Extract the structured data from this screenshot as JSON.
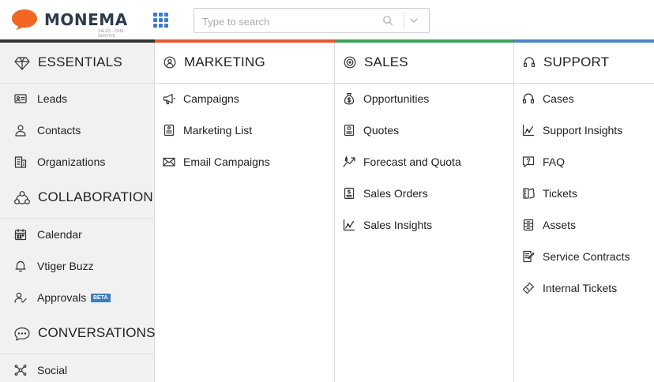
{
  "brand": {
    "name": "MONEMA",
    "tagline": "SALES · CRM · SERVICE",
    "logo_color": "#f26522"
  },
  "search": {
    "placeholder": "Type to search",
    "value": ""
  },
  "colors": {
    "essentials": "#333333",
    "marketing": "#e8572a",
    "sales": "#3aa35c",
    "support": "#4a86c8",
    "beta_badge": "#3b7dc4"
  },
  "essentials": {
    "title": "ESSENTIALS",
    "items": [
      {
        "label": "Leads",
        "icon": "id-card-icon"
      },
      {
        "label": "Contacts",
        "icon": "person-icon"
      },
      {
        "label": "Organizations",
        "icon": "building-icon"
      }
    ]
  },
  "collaboration": {
    "title": "COLLABORATION",
    "items": [
      {
        "label": "Calendar",
        "icon": "calendar-icon"
      },
      {
        "label": "Vtiger Buzz",
        "icon": "bell-icon"
      },
      {
        "label": "Approvals",
        "icon": "person-check-icon",
        "badge": "BETA"
      }
    ]
  },
  "conversations": {
    "title": "CONVERSATIONS",
    "items": [
      {
        "label": "Social",
        "icon": "network-icon"
      }
    ]
  },
  "marketing": {
    "title": "MARKETING",
    "items": [
      {
        "label": "Campaigns",
        "icon": "megaphone-icon"
      },
      {
        "label": "Marketing List",
        "icon": "list-icon"
      },
      {
        "label": "Email Campaigns",
        "icon": "envelope-icon"
      }
    ]
  },
  "sales": {
    "title": "SALES",
    "items": [
      {
        "label": "Opportunities",
        "icon": "money-bag-icon"
      },
      {
        "label": "Quotes",
        "icon": "quote-doc-icon"
      },
      {
        "label": "Forecast and Quota",
        "icon": "forecast-icon"
      },
      {
        "label": "Sales Orders",
        "icon": "order-doc-icon"
      },
      {
        "label": "Sales Insights",
        "icon": "chart-icon"
      }
    ]
  },
  "support": {
    "title": "SUPPORT",
    "items": [
      {
        "label": "Cases",
        "icon": "headset-icon"
      },
      {
        "label": "Support Insights",
        "icon": "chart-icon"
      },
      {
        "label": "FAQ",
        "icon": "question-bubble-icon"
      },
      {
        "label": "Tickets",
        "icon": "tickets-icon"
      },
      {
        "label": "Assets",
        "icon": "cabinet-icon"
      },
      {
        "label": "Service Contracts",
        "icon": "contract-icon"
      },
      {
        "label": "Internal Tickets",
        "icon": "ticket-icon"
      }
    ]
  }
}
